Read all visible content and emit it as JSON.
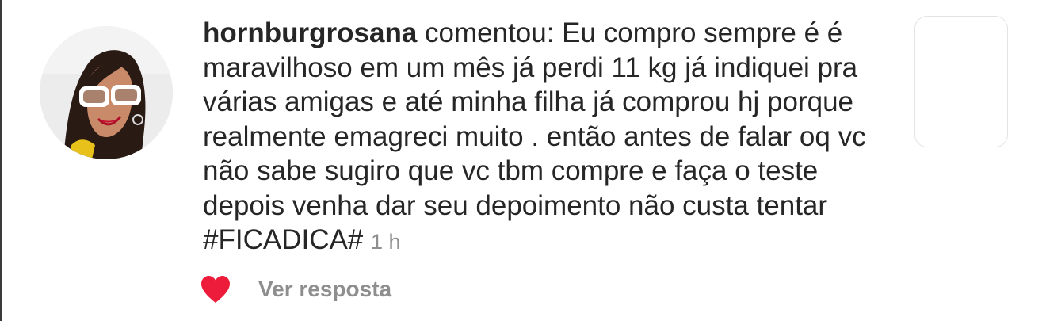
{
  "comment": {
    "username": "hornburgrosana",
    "text": " comentou: Eu compro sempre é é maravilhoso em um mês já perdi 11 kg  já indiquei pra várias amigas e até minha filha já comprou hj porque realmente emagreci muito . então antes de falar oq vc não sabe sugiro que vc tbm compre e faça o teste depois venha dar seu depoimento não custa tentar #FICADICA# ",
    "time": "1 h"
  },
  "actions": {
    "like_icon": "heart-icon",
    "like_color": "#ed1c3a",
    "reply_label": "Ver resposta"
  },
  "colors": {
    "text": "#262626",
    "muted": "#8e8e8e",
    "border": "#e3e3e3"
  }
}
